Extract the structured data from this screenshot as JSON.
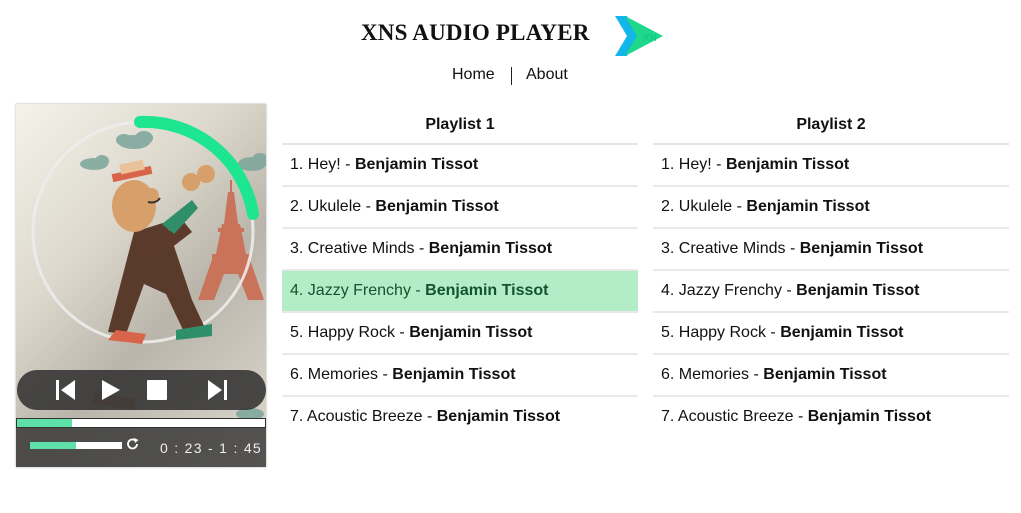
{
  "app": {
    "title": "XNS AUDIO PLAYER",
    "logo_icon": "chevron-play-logo",
    "accent_color": "#1ed98a",
    "logo_color": "#13b6e8"
  },
  "nav": {
    "items": [
      {
        "label": "Home"
      },
      {
        "label": "About"
      }
    ]
  },
  "player": {
    "artwork_icon": "jazz-man-paris-illustration",
    "controls": {
      "prev_icon": "skip-previous-icon",
      "play_icon": "play-icon",
      "stop_icon": "stop-icon",
      "next_icon": "skip-next-icon"
    },
    "progress_fraction": 0.22,
    "volume_fraction": 0.5,
    "repeat_icon": "repeat-icon",
    "time_text": "0 : 23 - 1 : 45"
  },
  "playlists": [
    {
      "title": "Playlist 1",
      "active_index": 3,
      "tracks": [
        {
          "number": "1.",
          "title": "Hey!",
          "separator": "-",
          "artist": "Benjamin Tissot"
        },
        {
          "number": "2.",
          "title": "Ukulele",
          "separator": "-",
          "artist": "Benjamin Tissot"
        },
        {
          "number": "3.",
          "title": "Creative Minds",
          "separator": "-",
          "artist": "Benjamin Tissot"
        },
        {
          "number": "4.",
          "title": "Jazzy Frenchy",
          "separator": "-",
          "artist": "Benjamin Tissot"
        },
        {
          "number": "5.",
          "title": "Happy Rock",
          "separator": "-",
          "artist": "Benjamin Tissot"
        },
        {
          "number": "6.",
          "title": "Memories",
          "separator": "-",
          "artist": "Benjamin Tissot"
        },
        {
          "number": "7.",
          "title": "Acoustic Breeze",
          "separator": "-",
          "artist": "Benjamin Tissot"
        }
      ]
    },
    {
      "title": "Playlist 2",
      "active_index": -1,
      "tracks": [
        {
          "number": "1.",
          "title": "Hey!",
          "separator": "-",
          "artist": "Benjamin Tissot"
        },
        {
          "number": "2.",
          "title": "Ukulele",
          "separator": "-",
          "artist": "Benjamin Tissot"
        },
        {
          "number": "3.",
          "title": "Creative Minds",
          "separator": "-",
          "artist": "Benjamin Tissot"
        },
        {
          "number": "4.",
          "title": "Jazzy Frenchy",
          "separator": "-",
          "artist": "Benjamin Tissot"
        },
        {
          "number": "5.",
          "title": "Happy Rock",
          "separator": "-",
          "artist": "Benjamin Tissot"
        },
        {
          "number": "6.",
          "title": "Memories",
          "separator": "-",
          "artist": "Benjamin Tissot"
        },
        {
          "number": "7.",
          "title": "Acoustic Breeze",
          "separator": "-",
          "artist": "Benjamin Tissot"
        }
      ]
    }
  ]
}
